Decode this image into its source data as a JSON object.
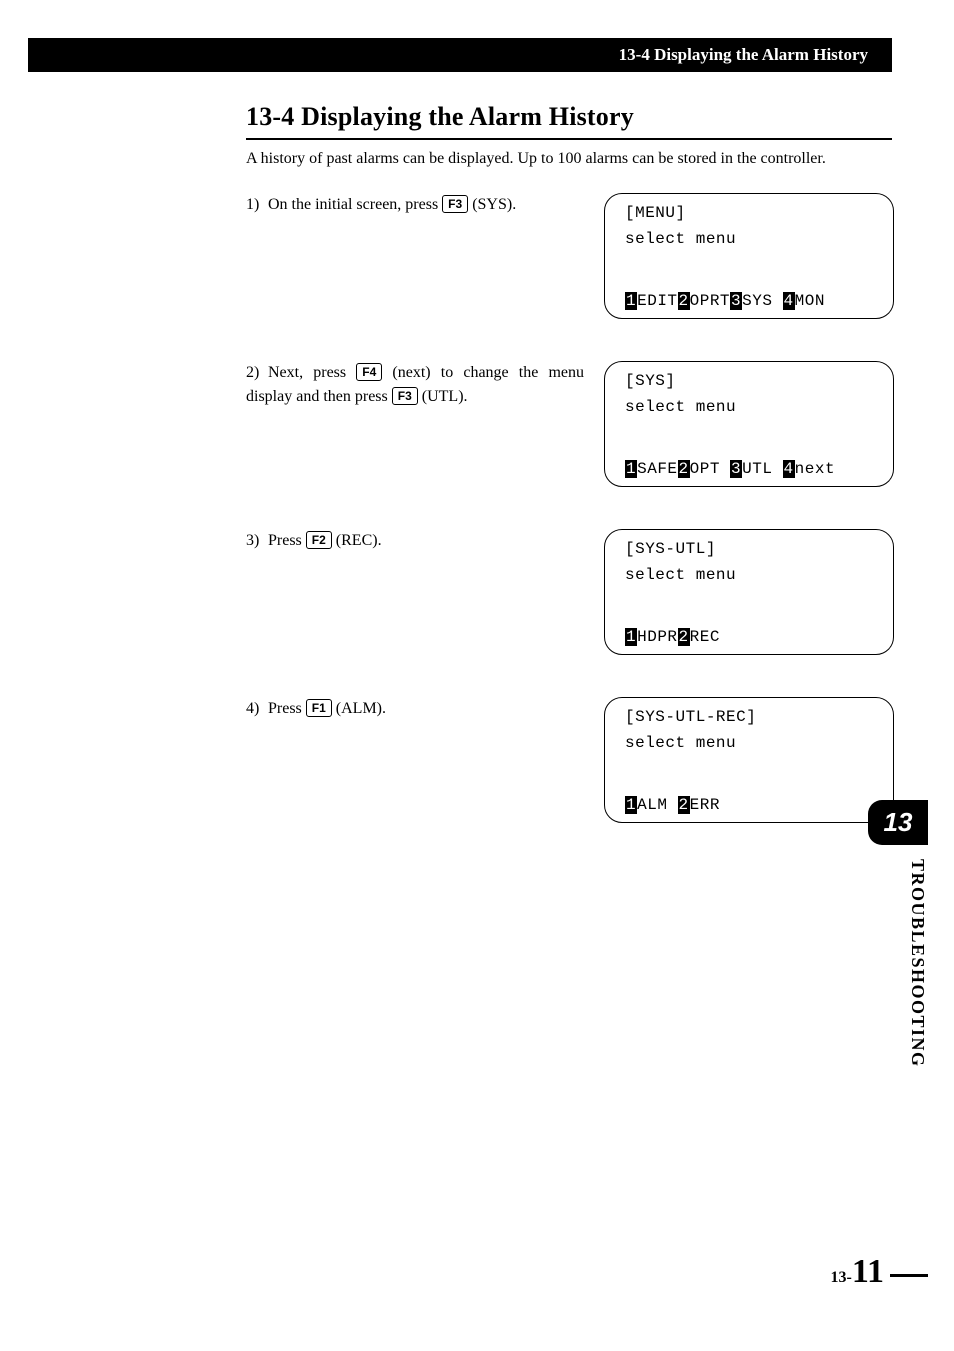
{
  "header_bar": "13-4 Displaying the Alarm History",
  "section_title": "13-4  Displaying the Alarm History",
  "intro": "A history of past alarms can be displayed. Up to 100 alarms can be stored in the controller.",
  "steps": [
    {
      "num": "1)",
      "text_a": "On the initial screen, press ",
      "key": "F3",
      "text_b": " (SYS).",
      "panel": {
        "title": "[MENU]",
        "subtitle": "select menu",
        "menu": [
          {
            "n": "1",
            "t": "EDIT"
          },
          {
            "n": "2",
            "t": "OPRT"
          },
          {
            "n": "3",
            "t": "SYS "
          },
          {
            "n": "4",
            "t": "MON"
          }
        ]
      }
    },
    {
      "num": "2)",
      "text_a": "Next, press ",
      "key": "F4",
      "text_b": " (next) to change the menu display and then press ",
      "key2": "F3",
      "text_c": " (UTL).",
      "panel": {
        "title": "[SYS]",
        "subtitle": "select menu",
        "menu": [
          {
            "n": "1",
            "t": "SAFE"
          },
          {
            "n": "2",
            "t": "OPT "
          },
          {
            "n": "3",
            "t": "UTL "
          },
          {
            "n": "4",
            "t": "next"
          }
        ]
      }
    },
    {
      "num": "3)",
      "text_a": "Press ",
      "key": "F2",
      "text_b": " (REC).",
      "panel": {
        "title": "[SYS-UTL]",
        "subtitle": "select menu",
        "menu": [
          {
            "n": "1",
            "t": "HDPR"
          },
          {
            "n": "2",
            "t": "REC"
          }
        ]
      }
    },
    {
      "num": "4)",
      "text_a": "Press ",
      "key": "F1",
      "text_b": " (ALM).",
      "panel": {
        "title": "[SYS-UTL-REC]",
        "subtitle": "select menu",
        "menu": [
          {
            "n": "1",
            "t": "ALM "
          },
          {
            "n": "2",
            "t": "ERR"
          }
        ]
      }
    }
  ],
  "side_tab_number": "13",
  "side_tab_label": "TROUBLESHOOTING",
  "page_num_prefix": "13-",
  "page_num": "11"
}
